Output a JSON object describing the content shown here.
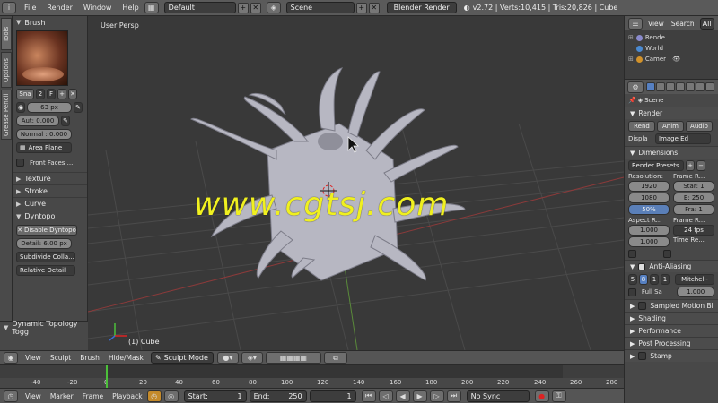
{
  "menubar": {
    "menus": [
      "File",
      "Render",
      "Window",
      "Help"
    ],
    "screen_layout": "Default",
    "scene": "Scene",
    "engine": "Blender Render",
    "stats": "v2.72 | Verts:10,415 | Tris:20,826 | Cube"
  },
  "toolshelf": {
    "tabs": [
      "Tools",
      "Options",
      "Grease Pencil"
    ],
    "brush_panel": "Brush",
    "brush_name_short": "Sna",
    "brush_users": "2",
    "brush_f": "F",
    "radius": "63 px",
    "strength": "Aut: 0.000",
    "normal": "Normal : 0.000",
    "area_plane": "Area Plane",
    "front_faces": "Front Faces ...",
    "collapsed_panels": [
      "Texture",
      "Stroke",
      "Curve",
      "Dyntopo"
    ],
    "disable_dyntopo": "Disable Dyntopo",
    "detail": "Detail: 6.00 px",
    "subdivide": "Subdivide Colla...",
    "relative_detail": "Relative Detail",
    "operator_panel": "Dynamic Topology Togg"
  },
  "viewport": {
    "view_label": "User Persp",
    "object_label": "(1) Cube",
    "watermark": "www.cgtsj.com"
  },
  "viewport_header": {
    "menus": [
      "View",
      "Sculpt",
      "Brush",
      "Hide/Mask"
    ],
    "mode": "Sculpt Mode"
  },
  "timeline": {
    "ticks": [
      "-40",
      "-20",
      "0",
      "20",
      "40",
      "60",
      "80",
      "100",
      "120",
      "140",
      "160",
      "180",
      "200",
      "220",
      "240",
      "260",
      "280"
    ]
  },
  "playback_bar": {
    "menus": [
      "View",
      "Marker",
      "Frame",
      "Playback"
    ],
    "start": "Start:",
    "start_val": "1",
    "end": "End:",
    "end_val": "250",
    "current": "1",
    "sync": "No Sync"
  },
  "outliner": {
    "menus": [
      "View",
      "Search",
      "All"
    ],
    "items": [
      "Rende",
      "World",
      "Camer"
    ]
  },
  "properties": {
    "scene": "Scene",
    "render_section": "Render",
    "render_buttons": [
      "Rend",
      "Anim",
      "Audio"
    ],
    "display_label": "Displa",
    "display_value": "Image Ed",
    "dimensions_section": "Dimensions",
    "render_presets": "Render Presets",
    "resolution_label": "Resolution:",
    "res_x": "1920",
    "res_y": "1080",
    "res_pct": "50%",
    "frame_range_label": "Frame R...",
    "frame_start": "Star: 1",
    "frame_end": "E: 250",
    "frame_step": "Fra: 1",
    "aspect_label": "Aspect R...",
    "aspect_x": "1.000",
    "aspect_y": "1.000",
    "frame_rate_label": "Frame R...",
    "fps": "24 fps",
    "time_remap": "Time Re...",
    "anti_aliasing": "Anti-Aliasing",
    "aa_samples": [
      "5",
      "8",
      "1",
      "1"
    ],
    "aa_filter": "Mitchell-",
    "full_sample": "Full Sa",
    "filter_size": "1.000",
    "sections_collapsed": [
      "Sampled Motion Bl",
      "Shading",
      "Performance",
      "Post Processing",
      "Stamp"
    ]
  }
}
